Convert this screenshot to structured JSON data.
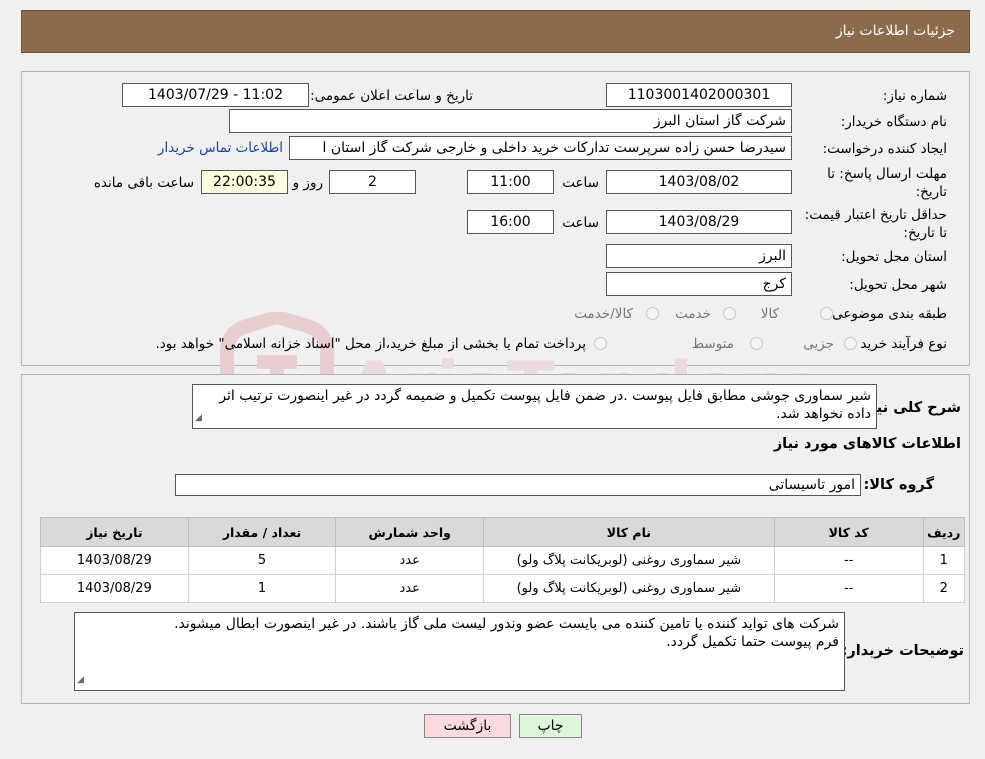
{
  "header": {
    "title": "جزئیات اطلاعات نیاز"
  },
  "watermark": {
    "text": "AriaTender.neT",
    "color": "#e8cfcf"
  },
  "details": {
    "need_number_label": "شماره نیاز:",
    "need_number": "1103001402000301",
    "announce_label": "تاریخ و ساعت اعلان عمومی:",
    "announce_value": "1403/07/29 - 11:02",
    "buyer_org_label": "نام دستگاه خریدار:",
    "buyer_org": "شرکت گاز استان البرز",
    "creator_label": "ایجاد کننده درخواست:",
    "creator": "سیدرضا حسن زاده سرپرست تدارکات خرید داخلی و خارجی شرکت گاز استان ا",
    "contact_link": "اطلاعات تماس خریدار",
    "reply_deadline_label": "مهلت ارسال پاسخ: تا تاریخ:",
    "reply_date": "1403/08/02",
    "time_label": "ساعت",
    "reply_time": "11:00",
    "days": "2",
    "days_label": "روز و",
    "remaining": "22:00:35",
    "remaining_label": "ساعت باقی مانده",
    "validity_label": "حداقل تاریخ اعتبار قیمت: تا تاریخ:",
    "validity_date": "1403/08/29",
    "validity_time": "16:00",
    "province_label": "استان محل تحویل:",
    "province": "البرز",
    "city_label": "شهر محل تحویل:",
    "city": "کرج",
    "category_label": "طبقه بندی موضوعی:",
    "category_options": [
      "کالا",
      "خدمت",
      "کالا/خدمت"
    ],
    "process_label": "نوع فرآیند خرید :",
    "process_options": [
      "جزیی",
      "متوسط"
    ],
    "process_note": "پرداخت تمام یا بخشی از مبلغ خرید،از محل \"اسناد خزانه اسلامی\" خواهد بود."
  },
  "description": {
    "label": "شرح کلی نیاز:",
    "text": "شیر سماوری جوشی مطابق فایل پیوست .در ضمن فایل پیوست تکمیل و ضمیمه گردد در غیر اینصورت ترتیب اثر داده نخواهد شد."
  },
  "goods": {
    "section_title": "اطلاعات کالاهای مورد نیاز",
    "group_label": "گروه کالا:",
    "group_value": "امور تاسیساتی",
    "columns": [
      "ردیف",
      "کد کالا",
      "نام کالا",
      "واحد شمارش",
      "تعداد / مقدار",
      "تاریخ نیاز"
    ],
    "rows": [
      [
        "1",
        "--",
        "شیر سماوری روغنی (لوبریکانت پلاگ ولو)",
        "عدد",
        "5",
        "1403/08/29"
      ],
      [
        "2",
        "--",
        "شیر سماوری روغنی (لوبریکانت پلاگ ولو)",
        "عدد",
        "1",
        "1403/08/29"
      ]
    ]
  },
  "buyer_notes": {
    "label": "توضیحات خریدار:",
    "line1": "شرکت های تواید کننده یا تامین کننده می بایست عضو وندور لیست ملی گاز باشند. در غیر اینصورت ابطال میشوند.",
    "line2": "فرم پیوست حتما تکمیل گردد."
  },
  "buttons": {
    "back": "بازگشت",
    "print": "چاپ"
  }
}
